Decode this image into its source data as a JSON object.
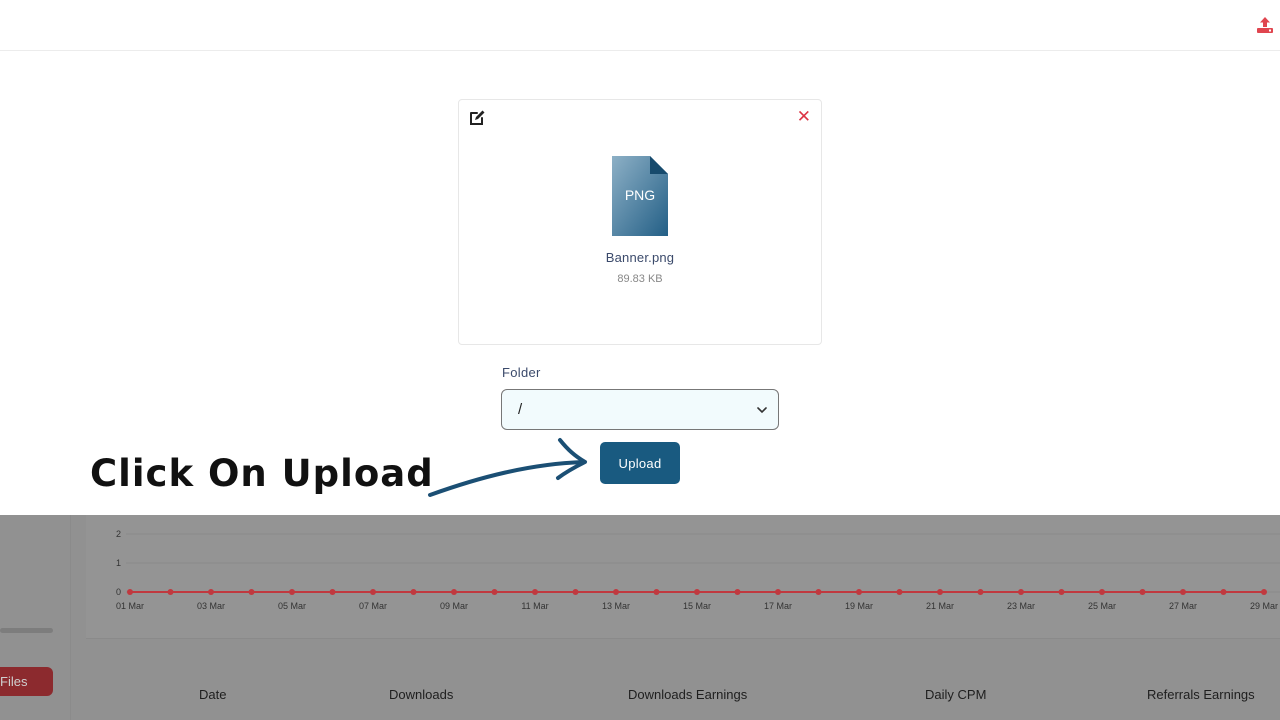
{
  "card": {
    "file_type": "PNG",
    "file_name": "Banner.png",
    "file_size": "89.83 KB"
  },
  "folder": {
    "label": "Folder",
    "selected": "/"
  },
  "upload_button": "Upload",
  "annotation": "Click On Upload",
  "colors": {
    "primary": "#195a80",
    "danger": "#dc3545",
    "chart_line": "#c0393f"
  },
  "chart_data": {
    "type": "line",
    "y_ticks": [
      "2",
      "1",
      "0"
    ],
    "x_tick_labels": [
      "01 Mar",
      "03 Mar",
      "05 Mar",
      "07 Mar",
      "09 Mar",
      "11 Mar",
      "13 Mar",
      "15 Mar",
      "17 Mar",
      "19 Mar",
      "21 Mar",
      "23 Mar",
      "25 Mar",
      "27 Mar",
      "29 Mar"
    ],
    "x": [
      1,
      2,
      3,
      4,
      5,
      6,
      7,
      8,
      9,
      10,
      11,
      12,
      13,
      14,
      15,
      16,
      17,
      18,
      19,
      20,
      21,
      22,
      23,
      24,
      25,
      26,
      27,
      28,
      29
    ],
    "values": [
      0,
      0,
      0,
      0,
      0,
      0,
      0,
      0,
      0,
      0,
      0,
      0,
      0,
      0,
      0,
      0,
      0,
      0,
      0,
      0,
      0,
      0,
      0,
      0,
      0,
      0,
      0,
      0,
      0
    ],
    "ylim": [
      0,
      2
    ],
    "grid": true
  },
  "sidebar": {
    "files_button": "Files"
  },
  "table": {
    "headers": [
      "Date",
      "Downloads",
      "Downloads Earnings",
      "Daily CPM",
      "Referrals Earnings"
    ]
  }
}
